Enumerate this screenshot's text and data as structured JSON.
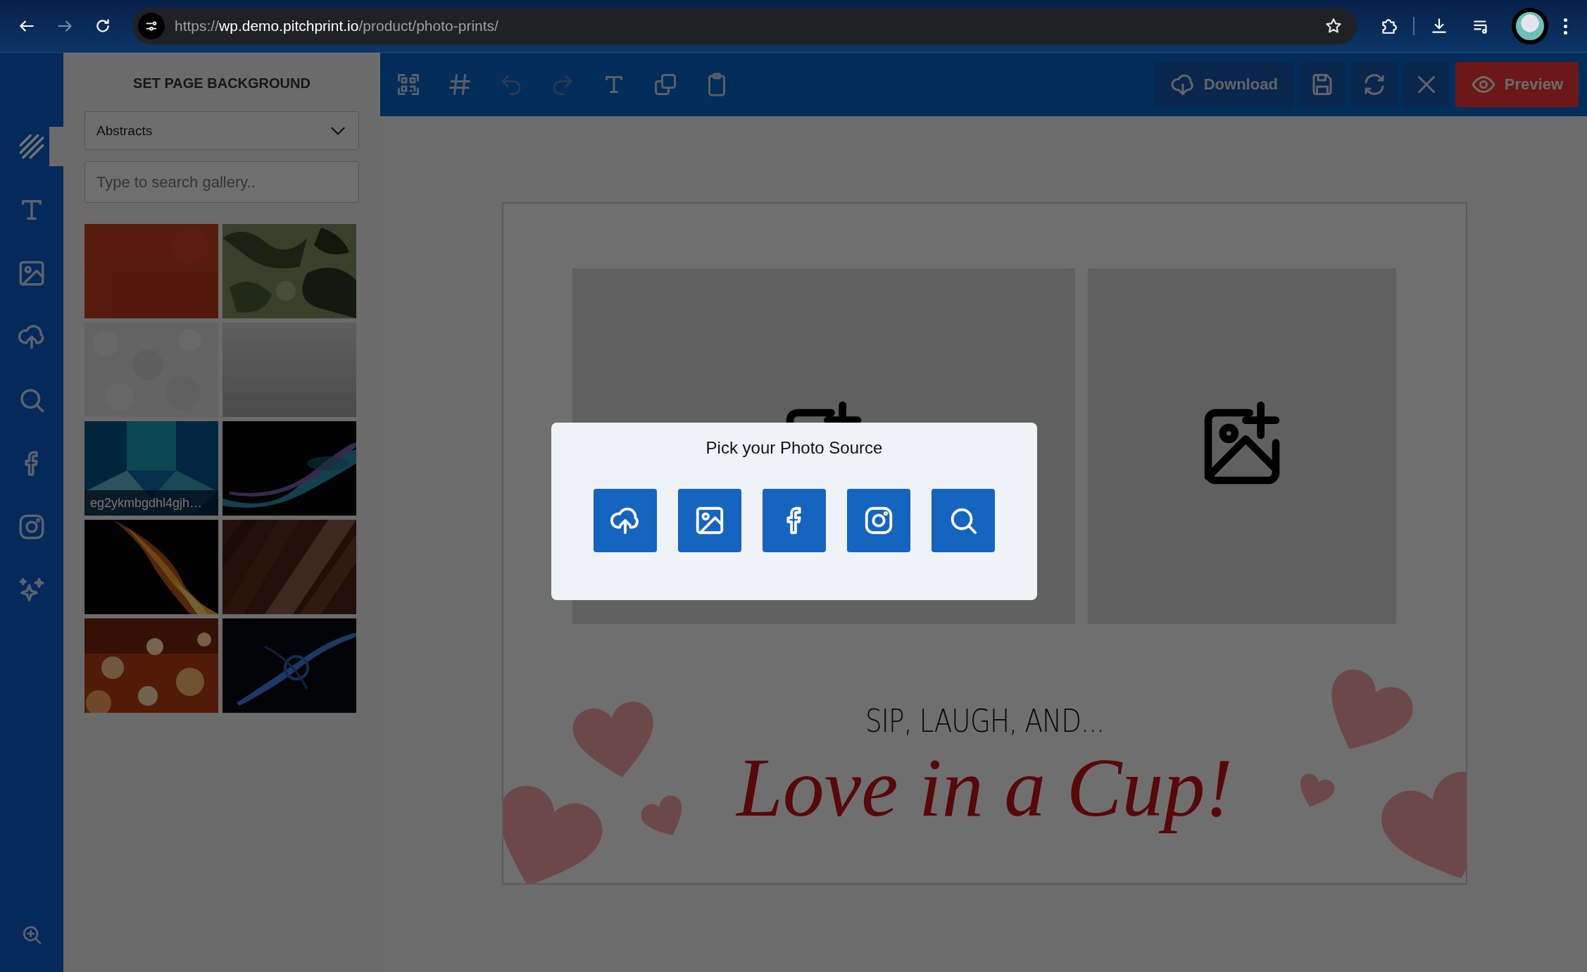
{
  "browser": {
    "nav": [
      {
        "disabled": false
      },
      {
        "disabled": true
      },
      {
        "disabled": false
      }
    ],
    "url": {
      "scheme": "https://",
      "host": "wp.demo.pitchprint.io",
      "path": "/product/photo-prints/"
    }
  },
  "rail": {
    "items": [
      {
        "selected": true
      },
      {
        "selected": false
      },
      {
        "selected": false
      },
      {
        "selected": false
      },
      {
        "selected": false
      },
      {
        "selected": false
      },
      {
        "selected": false
      },
      {
        "selected": false
      }
    ]
  },
  "panel": {
    "title": "SET PAGE BACKGROUND",
    "category": "Abstracts",
    "search": {
      "placeholder": "Type to search gallery.."
    },
    "thumbnails": [
      {
        "kind": "picture"
      },
      {
        "kind": "picture"
      },
      {
        "kind": "picture"
      },
      {
        "kind": "picture"
      },
      {
        "kind": "picture",
        "caption": "eg2ykmbgdhl4gjh…"
      },
      {
        "kind": "picture"
      },
      {
        "kind": "picture"
      },
      {
        "kind": "picture"
      },
      {
        "kind": "picture"
      },
      {
        "kind": "picture"
      }
    ]
  },
  "toolbar": {
    "tools": [
      {
        "disabled": false
      },
      {
        "disabled": false
      },
      {
        "disabled": true
      },
      {
        "disabled": true
      },
      {
        "disabled": false
      },
      {
        "disabled": false
      },
      {
        "disabled": false
      }
    ],
    "actions": [
      {
        "label": "Download",
        "kind": "default"
      },
      {
        "kind": "default"
      },
      {
        "kind": "default"
      },
      {
        "kind": "default"
      },
      {
        "label": "Preview",
        "kind": "primary"
      }
    ]
  },
  "canvas": {
    "tagline": "SIP, LAUGH, AND...",
    "headline": "Love in a Cup!"
  },
  "modal": {
    "title": "Pick your Photo Source"
  }
}
